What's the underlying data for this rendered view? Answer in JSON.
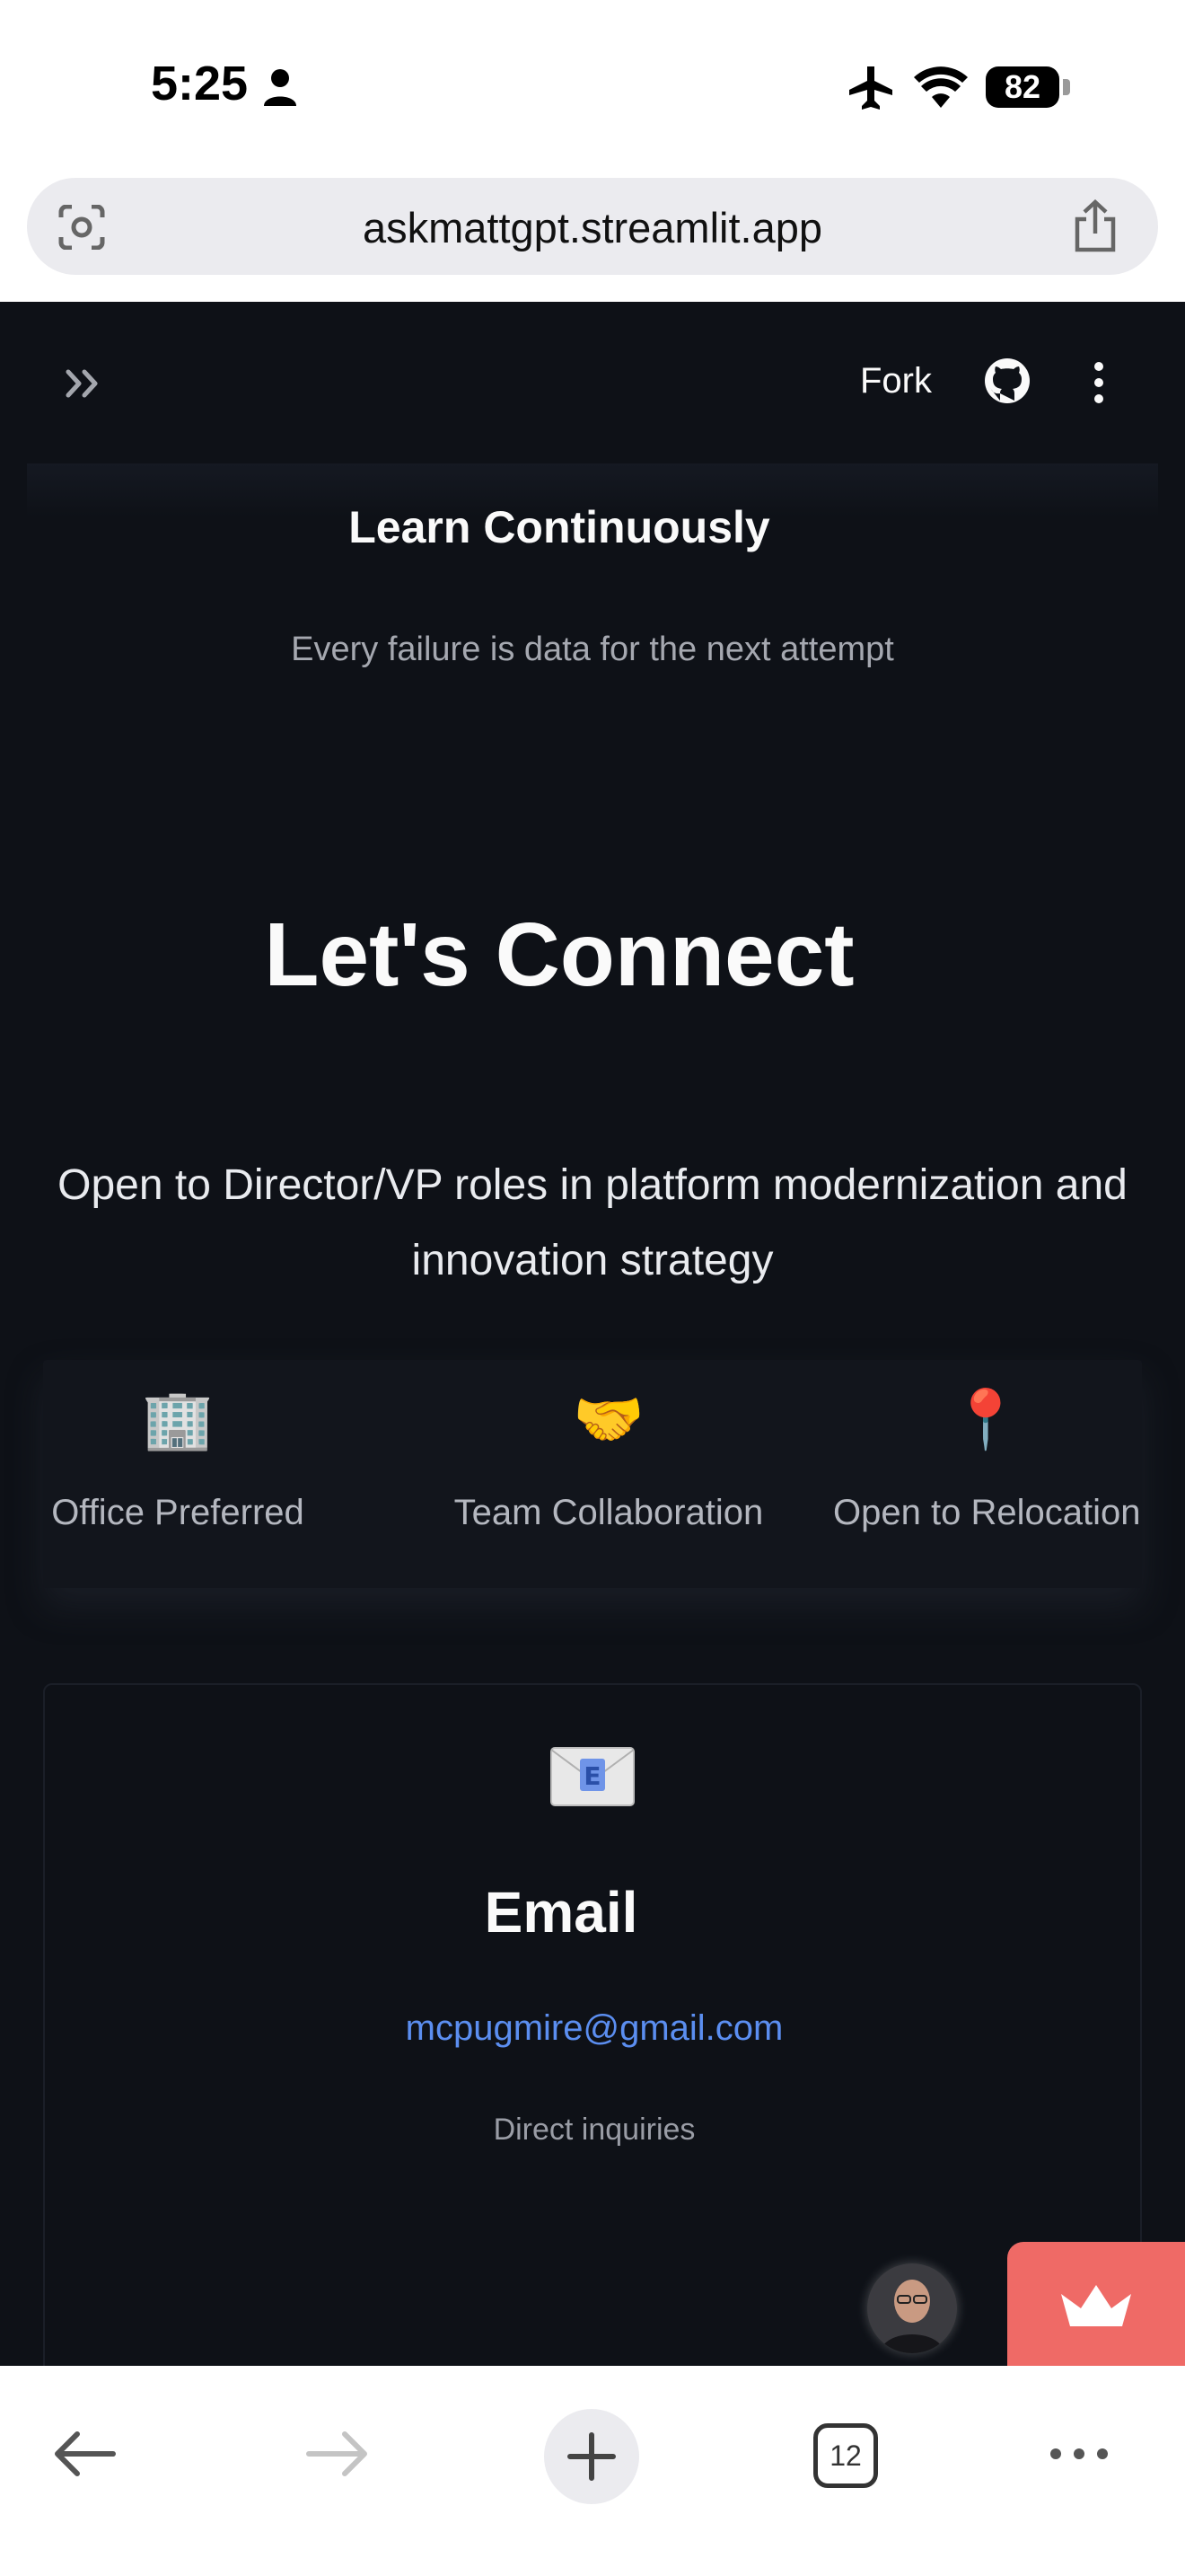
{
  "status_bar": {
    "time": "5:25",
    "battery": "82"
  },
  "browser": {
    "url": "askmattgpt.streamlit.app",
    "tab_count": "12"
  },
  "app_header": {
    "fork_label": "Fork"
  },
  "principle": {
    "title": "Learn Continuously",
    "subtitle": "Every failure is data for the next attempt"
  },
  "connect": {
    "heading": "Let's Connect",
    "subtitle": "Open to Director/VP roles in platform modernization and innovation strategy",
    "preferences": [
      {
        "emoji": "🏢",
        "label": "Office Preferred"
      },
      {
        "emoji": "🤝",
        "label": "Team Collaboration"
      },
      {
        "emoji": "📍",
        "label": "Open to Relocation"
      }
    ]
  },
  "email_card": {
    "title": "Email",
    "address": "mcpugmire@gmail.com",
    "note": "Direct inquiries"
  },
  "colors": {
    "app_background": "#0e1117",
    "link": "#5b8ef0",
    "streamlit_badge": "#ef6a66"
  }
}
